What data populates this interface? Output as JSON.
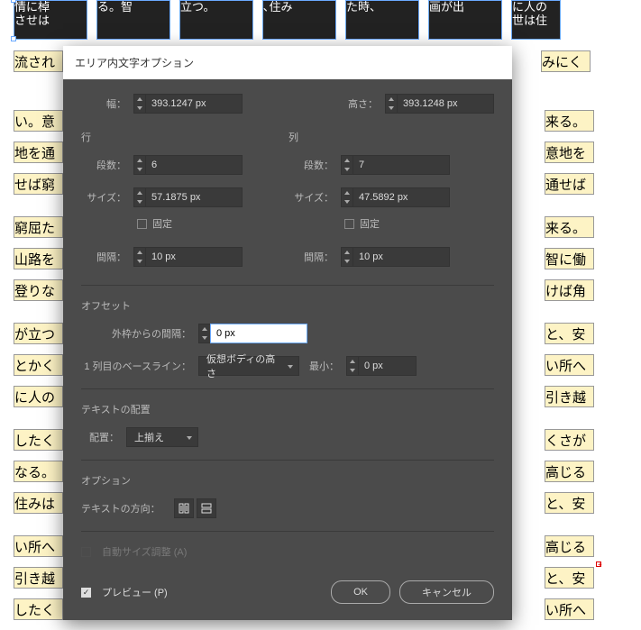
{
  "dialog": {
    "title": "エリア内文字オプション",
    "width_label": "幅：",
    "width_value": "393.1247 px",
    "height_label": "高さ：",
    "height_value": "393.1248 px",
    "rows_section": "行",
    "cols_section": "列",
    "count_label": "段数：",
    "row_count": "6",
    "col_count": "7",
    "size_label": "サイズ：",
    "row_size": "57.1875 px",
    "col_size": "47.5892 px",
    "fixed_label": "固定",
    "gutter_label": "間隔：",
    "row_gutter": "10 px",
    "col_gutter": "10 px",
    "offset_section": "オフセット",
    "inset_label": "外枠からの間隔：",
    "inset_value": "0 px",
    "baseline_label": "1 列目のベースライン：",
    "baseline_value": "仮想ボディの高さ",
    "min_label": "最小：",
    "min_value": "0 px",
    "textalign_section": "テキストの配置",
    "align_label": "配置：",
    "align_value": "上揃え",
    "options_section": "オプション",
    "textflow_label": "テキストの方向：",
    "autosize_label": "自動サイズ調整 (A)",
    "preview_label": "プレビュー (P)",
    "ok": "OK",
    "cancel": "キャンセル"
  },
  "bgtext": {
    "top": [
      "情に棹",
      "る。智",
      "立つ。",
      "､住み",
      "た時、",
      "画が出",
      "に人の"
    ],
    "toprow2a": "させは",
    "toprow2b": "世は住",
    "row3a": "流され",
    "row3b": "みにく",
    "right": [
      "来る。",
      "意地を",
      "通せば",
      "",
      "来る。",
      "智に働",
      "けば角",
      "",
      "と、安",
      "い所へ",
      "引き越",
      "",
      "くさが",
      "高じる",
      "と、安",
      "",
      "高じる",
      "と、安",
      "い所へ"
    ],
    "left": [
      "い。意",
      "地を通",
      "せば窮",
      "",
      "窮屈た",
      "山路を",
      "登りな",
      "",
      "が立つ",
      "とかく",
      "に人の",
      "",
      "したく",
      "なる。",
      "住みは",
      "",
      "い所へ",
      "引き越",
      "したく"
    ]
  }
}
